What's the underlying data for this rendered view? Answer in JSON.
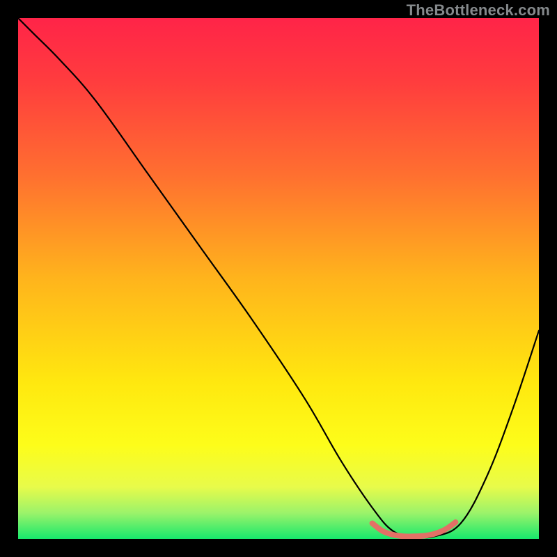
{
  "watermark": "TheBottleneck.com",
  "chart_data": {
    "type": "line",
    "title": "",
    "xlabel": "",
    "ylabel": "",
    "xlim": [
      0,
      100
    ],
    "ylim": [
      0,
      100
    ],
    "grid": false,
    "legend": false,
    "gradient_stops": [
      {
        "offset": 0.0,
        "color": "#ff2448"
      },
      {
        "offset": 0.12,
        "color": "#ff3c3e"
      },
      {
        "offset": 0.3,
        "color": "#ff6f30"
      },
      {
        "offset": 0.5,
        "color": "#ffb41c"
      },
      {
        "offset": 0.7,
        "color": "#ffe80f"
      },
      {
        "offset": 0.82,
        "color": "#fdfd1a"
      },
      {
        "offset": 0.9,
        "color": "#e8fb4a"
      },
      {
        "offset": 0.95,
        "color": "#9cf36a"
      },
      {
        "offset": 1.0,
        "color": "#17e86c"
      }
    ],
    "series": [
      {
        "name": "bottleneck-curve",
        "stroke": "#000000",
        "x": [
          0,
          3,
          8,
          15,
          25,
          35,
          45,
          55,
          62,
          68,
          72,
          76,
          80,
          85,
          90,
          95,
          100
        ],
        "y": [
          100,
          97,
          92,
          84,
          70,
          56,
          42,
          27,
          15,
          6,
          1.5,
          0.5,
          0.5,
          3,
          12,
          25,
          40
        ]
      },
      {
        "name": "optimal-marker",
        "stroke": "#e37066",
        "x": [
          68,
          70,
          72,
          74,
          76,
          78,
          80,
          82,
          84
        ],
        "y": [
          3.0,
          1.5,
          0.8,
          0.5,
          0.5,
          0.6,
          1.0,
          1.8,
          3.2
        ]
      }
    ]
  }
}
